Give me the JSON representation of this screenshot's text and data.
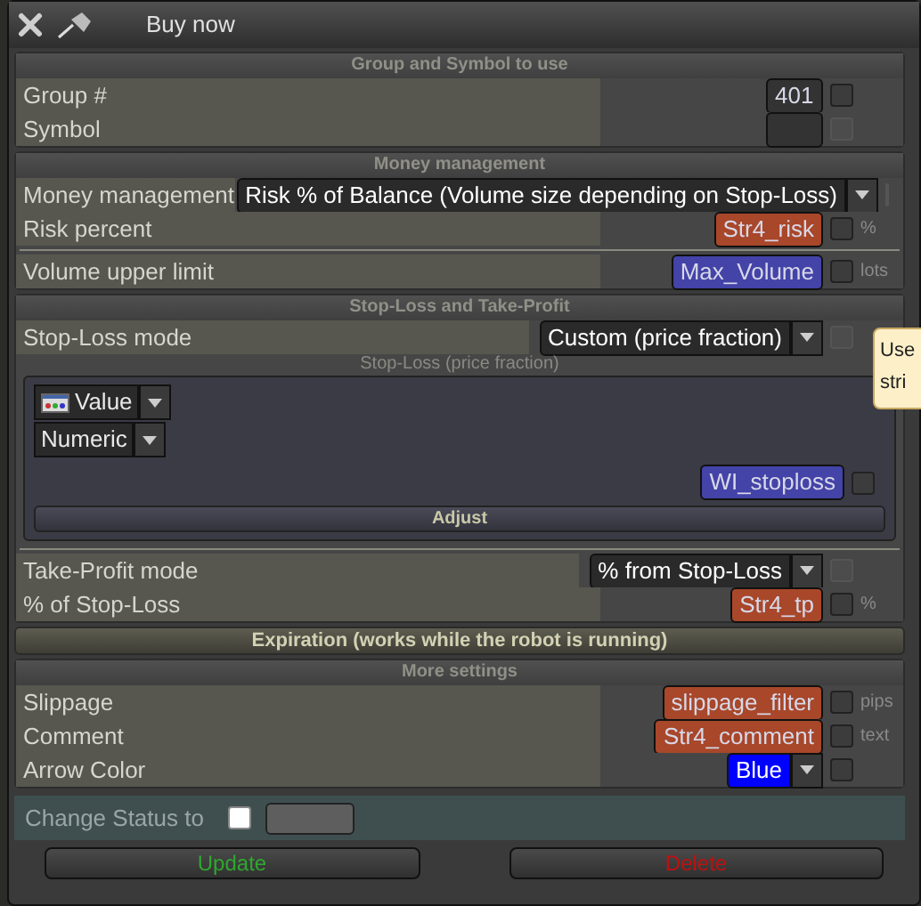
{
  "window": {
    "title": "Buy now"
  },
  "sections": [
    {
      "kind": "panel",
      "title": "Group and Symbol to use",
      "rows": [
        {
          "kind": "input",
          "label": "Group #",
          "value": "401",
          "color": "#333333",
          "check_disabled": false
        },
        {
          "kind": "input",
          "label": "Symbol",
          "color": "#333333",
          "check_disabled": true
        }
      ]
    },
    {
      "kind": "panel",
      "title": "Money management",
      "rows": [
        {
          "kind": "select",
          "label": "Money management",
          "value": "Risk % of Balance (Volume size depending on Stop-Loss)",
          "check_disabled": true
        },
        {
          "kind": "input",
          "label": "Risk percent",
          "value": "Str4_risk",
          "color": "#a8472a",
          "check_disabled": false,
          "unit": "%"
        },
        {
          "kind": "divider"
        },
        {
          "kind": "input",
          "label": "Volume upper limit",
          "value": "Max_Volume",
          "color": "#4343a8",
          "check_disabled": false,
          "unit": "lots"
        }
      ]
    },
    {
      "kind": "panel",
      "title": "Stop-Loss and Take-Profit",
      "rows": [
        {
          "kind": "select",
          "label": "Stop-Loss mode",
          "value": "Custom (price fraction)",
          "check_disabled": true
        },
        {
          "kind": "subpanel",
          "title": "Stop-Loss (price fraction)",
          "dropdowns": [
            "Value",
            "Numeric"
          ],
          "field": {
            "value": "WI_stoploss",
            "color": "#4343a8",
            "check_disabled": false
          },
          "button": "Adjust"
        },
        {
          "kind": "divider"
        },
        {
          "kind": "select",
          "label": "Take-Profit mode",
          "value": "% from Stop-Loss",
          "check_disabled": true
        },
        {
          "kind": "input",
          "label": "% of Stop-Loss",
          "value": "Str4_tp",
          "color": "#a8472a",
          "check_disabled": false,
          "unit": "%"
        }
      ]
    },
    {
      "kind": "collapsed",
      "title": "Expiration (works while the robot is running)"
    },
    {
      "kind": "panel",
      "title": "More settings",
      "rows": [
        {
          "kind": "input",
          "label": "Slippage",
          "value": "slippage_filter",
          "color": "#a8472a",
          "check_disabled": false,
          "unit": "pips"
        },
        {
          "kind": "input",
          "label": "Comment",
          "value": "Str4_comment",
          "color": "#a8472a",
          "check_disabled": false,
          "unit": "text"
        },
        {
          "kind": "select",
          "label": "Arrow Color",
          "value": "Blue",
          "color": "#0000ff",
          "check_disabled": false
        }
      ]
    }
  ],
  "status": {
    "label": "Change Status to",
    "checked": false
  },
  "buttons": [
    {
      "label": "Update",
      "color": "#2ea82e"
    },
    {
      "label": "Delete",
      "color": "#c01010"
    }
  ],
  "tooltip": {
    "lines": [
      "Use",
      "stri"
    ]
  }
}
